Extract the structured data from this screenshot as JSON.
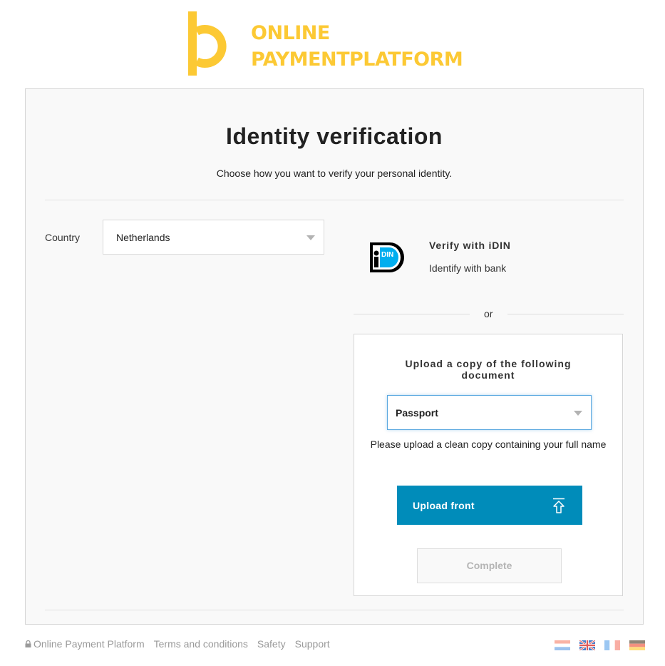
{
  "brand": {
    "name_line1": "ONLINE",
    "name_line2": "PAYMENTPLATFORM",
    "color": "#fcc934"
  },
  "page": {
    "title": "Identity verification",
    "subtitle": "Choose how you want to verify your personal identity."
  },
  "country": {
    "label": "Country",
    "selected": "Netherlands"
  },
  "idin": {
    "logo_text": "iDIN",
    "title": "Verify with iDIN",
    "subtitle": "Identify with bank"
  },
  "separator": {
    "text": "or"
  },
  "upload": {
    "title": "Upload a copy of the following document",
    "document_type": "Passport",
    "hint": "Please upload a clean copy containing your full name",
    "upload_front_label": "Upload front",
    "complete_label": "Complete",
    "accent_color": "#008cba"
  },
  "footer": {
    "links": [
      "Online Payment Platform",
      "Terms and conditions",
      "Safety",
      "Support"
    ],
    "languages": [
      "Dutch",
      "English",
      "French",
      "German"
    ]
  }
}
